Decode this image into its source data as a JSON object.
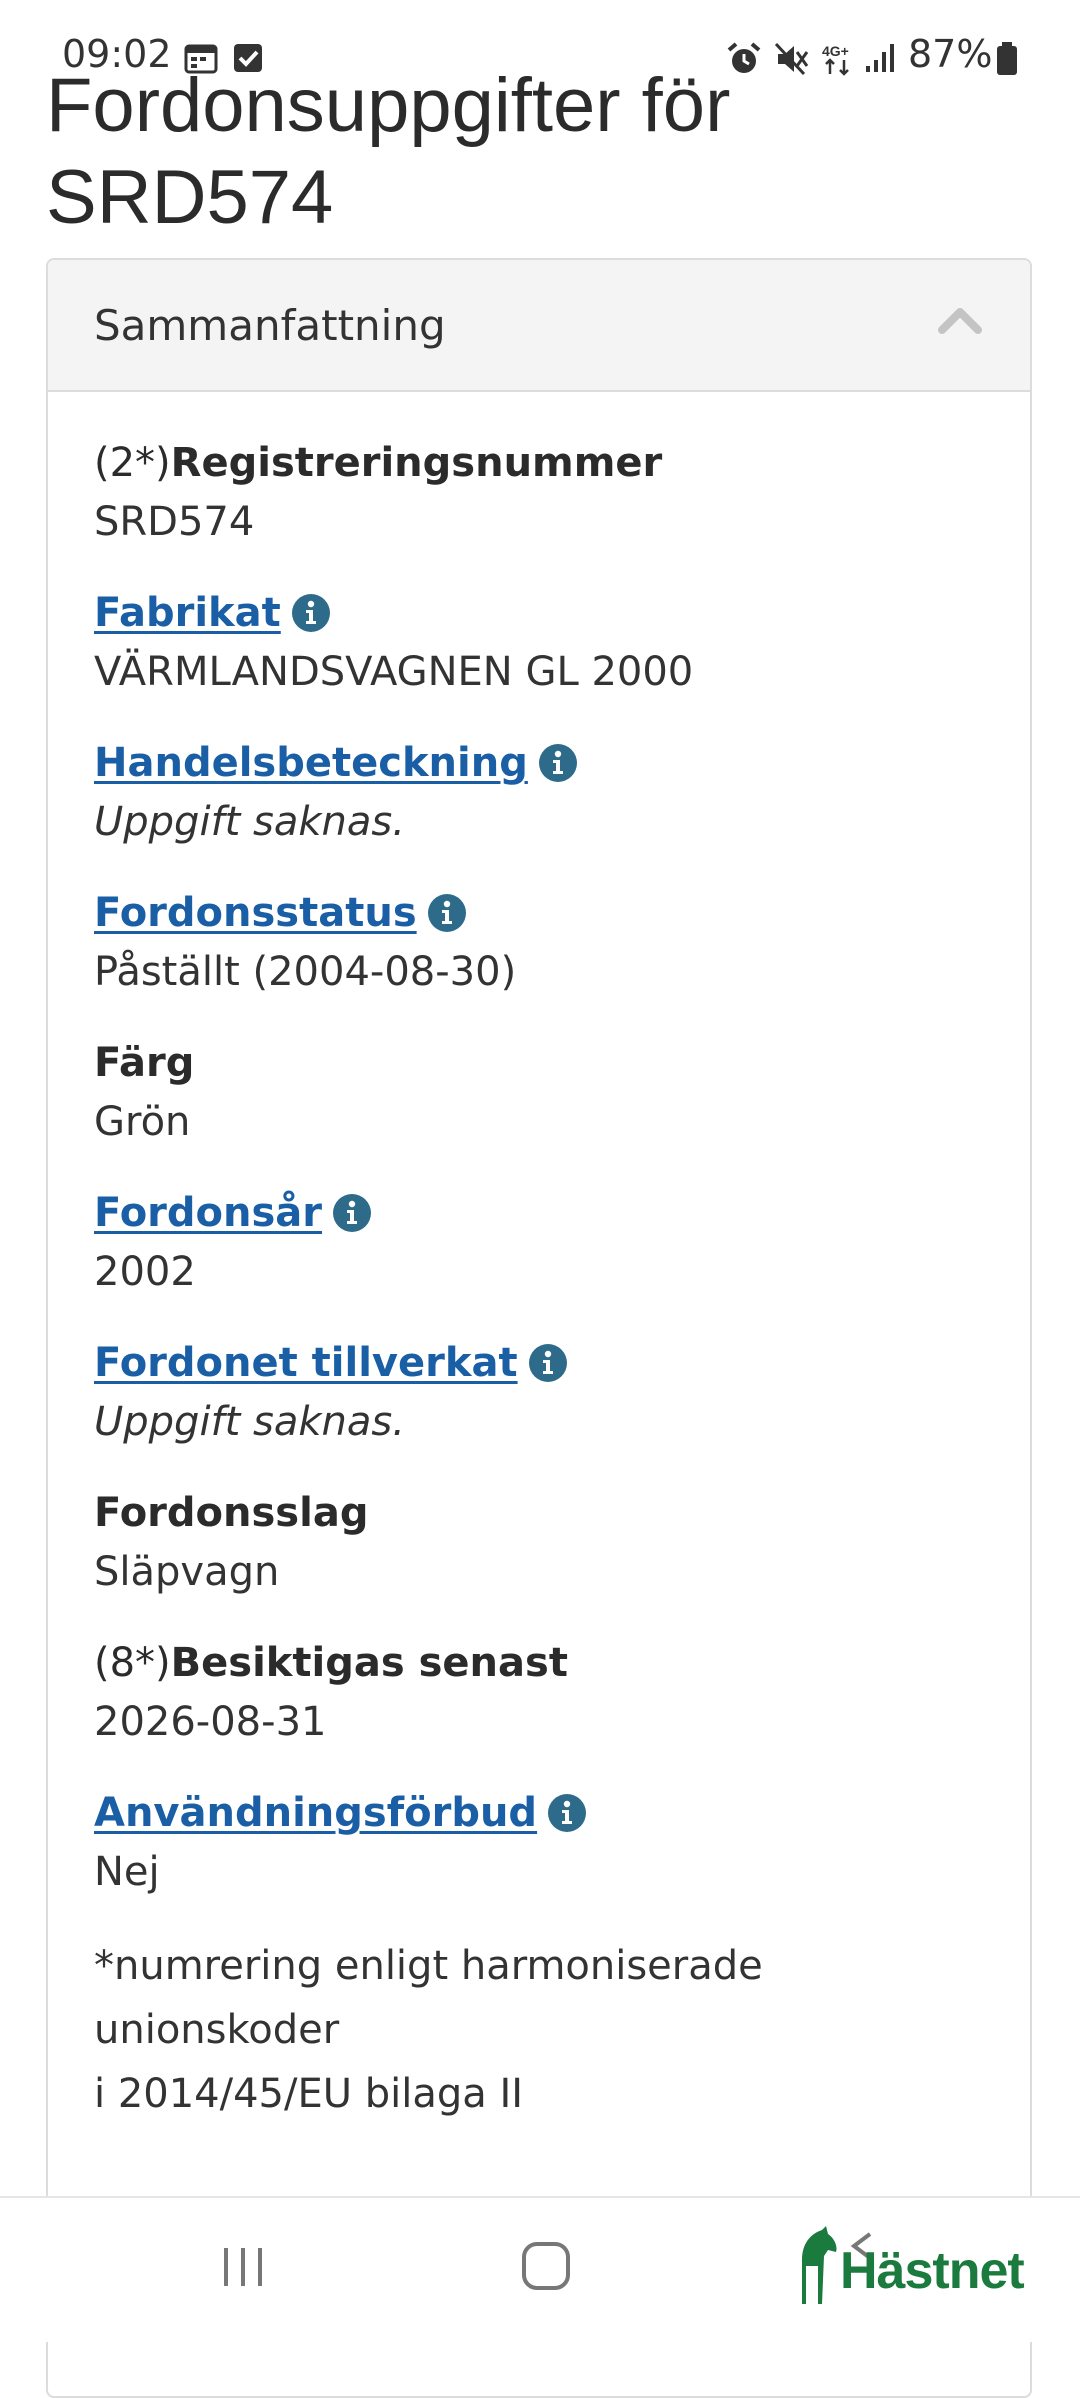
{
  "status_bar": {
    "time": "09:02",
    "battery": "87%",
    "icons": [
      "calendar-icon",
      "checkbox-icon",
      "alarm-icon",
      "mute-icon",
      "4g-icon",
      "signal-icon",
      "battery-icon"
    ]
  },
  "page": {
    "title_line1": "Fordonsuppgifter för",
    "title_line2": "SRD574"
  },
  "panel": {
    "title": "Sammanfattning",
    "fields": [
      {
        "prefix": "(2*)",
        "label": "Registreringsnummer",
        "link": false,
        "value": "SRD574",
        "missing": false
      },
      {
        "prefix": "",
        "label": "Fabrikat",
        "link": true,
        "value": "VÄRMLANDSVAGNEN GL 2000",
        "missing": false
      },
      {
        "prefix": "",
        "label": "Handelsbeteckning",
        "link": true,
        "value": "Uppgift saknas.",
        "missing": true
      },
      {
        "prefix": "",
        "label": "Fordonsstatus",
        "link": true,
        "value": "Påställt (2004-08-30)",
        "missing": false
      },
      {
        "prefix": "",
        "label": "Färg",
        "link": false,
        "value": "Grön",
        "missing": false
      },
      {
        "prefix": "",
        "label": "Fordonsår",
        "link": true,
        "value": "2002",
        "missing": false
      },
      {
        "prefix": "",
        "label": "Fordonet tillverkat",
        "link": true,
        "value": "Uppgift saknas.",
        "missing": true
      },
      {
        "prefix": "",
        "label": "Fordonsslag",
        "link": false,
        "value": "Släpvagn",
        "missing": false
      },
      {
        "prefix": "(8*)",
        "label": "Besiktigas senast",
        "link": false,
        "value": "2026-08-31",
        "missing": false
      },
      {
        "prefix": "",
        "label": "Användningsförbud",
        "link": true,
        "value": "Nej",
        "missing": false
      }
    ],
    "footnote_line1": "*numrering enligt harmoniserade unionskoder",
    "footnote_line2": "i 2014/45/EU bilaga II"
  },
  "nav_bar": {
    "brand": "Hästnet"
  },
  "colors": {
    "link": "#1a5fa6",
    "info_icon": "#2e6b8a",
    "brand": "#1b7a3e"
  }
}
